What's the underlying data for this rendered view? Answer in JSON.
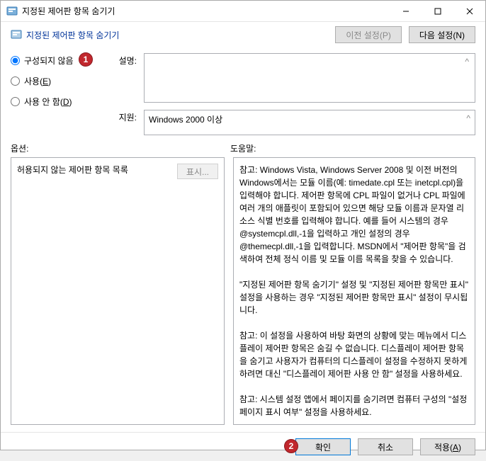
{
  "window": {
    "title": "지정된 제어판 항목 숨기기"
  },
  "header": {
    "title": "지정된 제어판 항목 숨기기",
    "prev_label": "이전 설정(P)",
    "next_label": "다음 설정(N)"
  },
  "radios": {
    "not_configured": "구성되지 않음",
    "enabled_pre": "사용(",
    "enabled_mn": "E",
    "enabled_post": ")",
    "disabled_pre": "사용 안 함(",
    "disabled_mn": "D",
    "disabled_post": ")"
  },
  "fields": {
    "desc_label": "설명:",
    "support_label": "지원:",
    "support_value": "Windows 2000 이상"
  },
  "options": {
    "label": "옵션:",
    "help_label": "도움말:",
    "list_label": "허용되지 않는 제어판 항목 목록",
    "show_btn": "표시..."
  },
  "help_text": "참고: Windows Vista, Windows Server 2008 및 이전 버전의 Windows에서는 모듈 이름(예: timedate.cpl 또는 inetcpl.cpl)을 입력해야 합니다. 제어판 항목에 CPL 파일이 없거나 CPL 파일에 여러 개의 애플릿이 포함되어 있으면 해당 모듈 이름과 문자열 리소스 식별 번호를 입력해야 합니다. 예를 들어 시스템의 경우 @systemcpl.dll,-1을 입력하고 개인 설정의 경우 @themecpl.dll,-1을 입력합니다. MSDN에서 \"제어판 항목\"을 검색하여 전체 정식 이름 및 모듈 이름 목록을 찾을 수 있습니다.\n\n\"지정된 제어판 항목 숨기기\" 설정 및 \"지정된 제어판 항목만 표시\" 설정을 사용하는 경우 \"지정된 제어판 항목만 표시\" 설정이 무시됩니다.\n\n참고: 이 설정을 사용하여 바탕 화면의 상황에 맞는 메뉴에서 디스플레이 제어판 항목은 숨길 수 없습니다. 디스플레이 제어판 항목을 숨기고 사용자가 컴퓨터의 디스플레이 설정을 수정하지 못하게 하려면 대신 \"디스플레이 제어판 사용 안 함\" 설정을 사용하세요.\n\n참고: 시스템 설정 앱에서 페이지를 숨기려면 컴퓨터 구성의 \"설정 페이지 표시 여부\" 설정을 사용하세요.",
  "buttons": {
    "ok": "확인",
    "cancel": "취소",
    "apply_pre": "적용(",
    "apply_mn": "A",
    "apply_post": ")"
  },
  "markers": {
    "m1": "1",
    "m2": "2"
  }
}
